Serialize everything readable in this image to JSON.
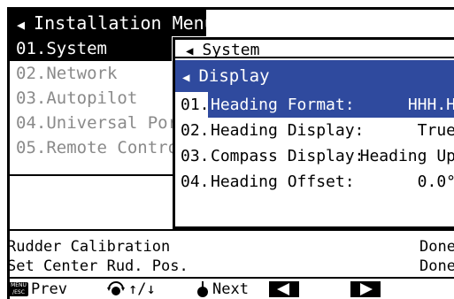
{
  "installation_menu": {
    "title": "Installation Menu",
    "items": [
      {
        "num": "01.",
        "label": "System"
      },
      {
        "num": "02.",
        "label": "Network"
      },
      {
        "num": "03.",
        "label": "Autopilot"
      },
      {
        "num": "04.",
        "label": "Universal Port"
      },
      {
        "num": "05.",
        "label": "Remote Controller"
      }
    ]
  },
  "popup": {
    "system_title": "System",
    "display_title": "Display",
    "items": [
      {
        "num": "01.",
        "label": "Heading Format:",
        "value": "HHH.H"
      },
      {
        "num": "02.",
        "label": "Heading Display:",
        "value": "True"
      },
      {
        "num": "03.",
        "label": "Compass Display:",
        "value": "Heading Up"
      },
      {
        "num": "04.",
        "label": "Heading Offset:",
        "value": "0.0°"
      }
    ]
  },
  "status": [
    {
      "label": "Rudder Calibration",
      "value": "Done"
    },
    {
      "label": "Set Center Rud. Pos.",
      "value": "Done"
    }
  ],
  "footer": {
    "menu_key_top": "MENU",
    "menu_key_bottom": "/ESC",
    "prev_label": "Prev",
    "arrows_label": "↑/↓",
    "next_label": "Next"
  },
  "colors": {
    "selection_blue": "#2f4a9e",
    "dim_text": "#8a8a8a"
  }
}
